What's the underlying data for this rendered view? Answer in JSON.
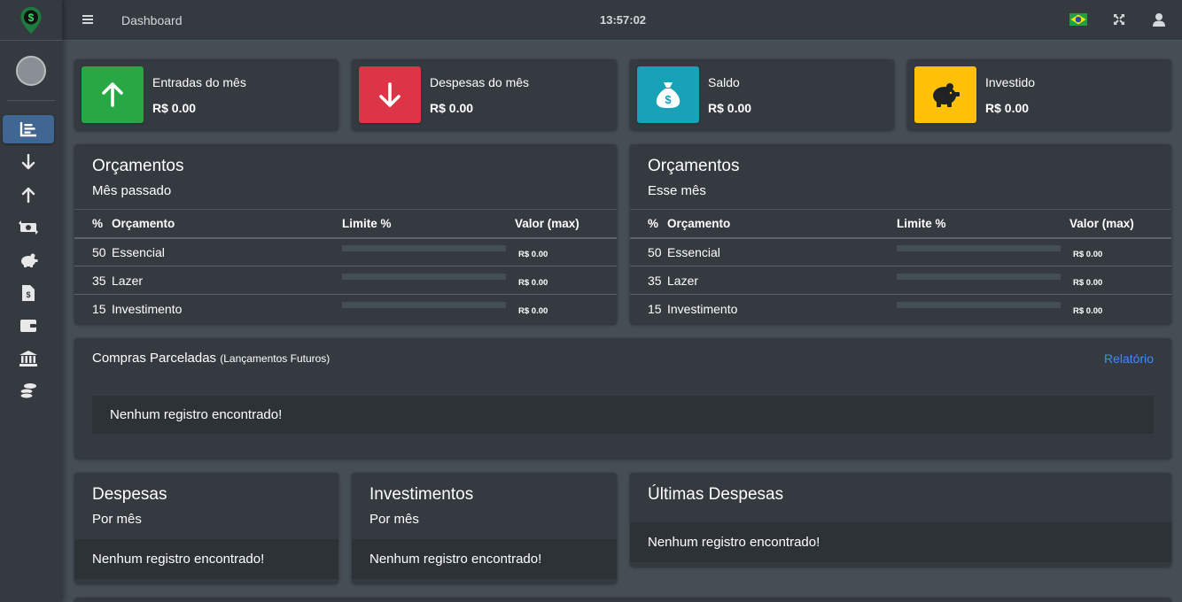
{
  "topbar": {
    "title": "Dashboard",
    "clock": "13:57:02"
  },
  "sidebar": {
    "items": [
      {
        "icon": "chart-icon",
        "active": true
      },
      {
        "icon": "arrow-down-icon"
      },
      {
        "icon": "arrow-up-icon"
      },
      {
        "icon": "money-exchange-icon"
      },
      {
        "icon": "piggy-bank-icon"
      },
      {
        "icon": "invoice-icon"
      },
      {
        "icon": "wallet-icon"
      },
      {
        "icon": "bank-icon"
      },
      {
        "icon": "coins-icon"
      }
    ]
  },
  "summary": [
    {
      "label": "Entradas do mês",
      "value": "R$ 0.00",
      "color": "#28a745",
      "icon": "arrow-up-icon"
    },
    {
      "label": "Despesas do mês",
      "value": "R$ 0.00",
      "color": "#dc3545",
      "icon": "arrow-down-icon"
    },
    {
      "label": "Saldo",
      "value": "R$ 0.00",
      "color": "#17a2b8",
      "icon": "money-bag-icon"
    },
    {
      "label": "Investido",
      "value": "R$ 0.00",
      "color": "#ffc107",
      "icon": "piggy-bank-icon"
    }
  ],
  "budget_columns": {
    "pct": "%",
    "name": "Orçamento",
    "limit": "Limite %",
    "value": "Valor (max)"
  },
  "budget_last": {
    "title": "Orçamentos",
    "subtitle": "Mês passado",
    "rows": [
      {
        "pct": "50",
        "name": "Essencial",
        "progress": 0,
        "value": "R$ 0.00"
      },
      {
        "pct": "35",
        "name": "Lazer",
        "progress": 0,
        "value": "R$ 0.00"
      },
      {
        "pct": "15",
        "name": "Investimento",
        "progress": 0,
        "value": "R$ 0.00"
      }
    ]
  },
  "budget_this": {
    "title": "Orçamentos",
    "subtitle": "Esse mês",
    "rows": [
      {
        "pct": "50",
        "name": "Essencial",
        "progress": 0,
        "value": "R$ 0.00"
      },
      {
        "pct": "35",
        "name": "Lazer",
        "progress": 0,
        "value": "R$ 0.00"
      },
      {
        "pct": "15",
        "name": "Investimento",
        "progress": 0,
        "value": "R$ 0.00"
      }
    ]
  },
  "installments": {
    "title": "Compras Parceladas",
    "note": "(Lançamentos Futuros)",
    "link": "Relatório",
    "empty": "Nenhum registro encontrado!"
  },
  "expenses": {
    "title": "Despesas",
    "subtitle": "Por mês",
    "empty": "Nenhum registro encontrado!"
  },
  "investments": {
    "title": "Investimentos",
    "subtitle": "Por mês",
    "empty": "Nenhum registro encontrado!"
  },
  "latest": {
    "title": "Últimas Despesas",
    "empty": "Nenhum registro encontrado!"
  }
}
